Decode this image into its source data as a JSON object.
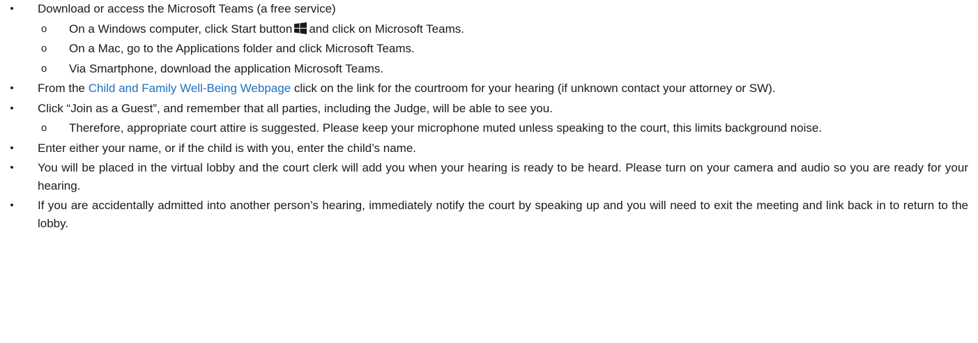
{
  "bullet_glyph": "•",
  "sub_bullet_glyph": "o",
  "items": [
    {
      "text": "Download or access the Microsoft Teams (a free service)",
      "sub": [
        {
          "before": "On a Windows computer, click Start button",
          "icon": "windows-logo-icon",
          "after": "and click on Microsoft Teams."
        },
        {
          "text": "On a Mac, go to the Applications folder and click Microsoft Teams."
        },
        {
          "text": "Via Smartphone, download the application Microsoft Teams."
        }
      ]
    },
    {
      "before": "From the ",
      "link": "Child and Family Well-Being Webpage",
      "after": " click on the link for the courtroom for your hearing (if unknown contact your attorney or SW)."
    },
    {
      "text": "Click “Join as a Guest”, and remember that all parties, including the Judge, will be able to see you.",
      "sub": [
        {
          "text": "Therefore, appropriate court attire is suggested. Please keep your microphone muted unless speaking to the court, this limits background noise."
        }
      ]
    },
    {
      "text": "Enter either your name, or if the child is with you, enter the child’s name."
    },
    {
      "text": "You will be placed in the virtual lobby and the court clerk will add you when your hearing is ready to be heard. Please turn on your camera and audio so you are ready for your hearing."
    },
    {
      "text": "If you are accidentally admitted into another person’s hearing, immediately notify the court by speaking up and you will need to exit the meeting and link back in to return to the lobby."
    }
  ],
  "colors": {
    "text": "#1a1a1a",
    "link": "#1f6fbf"
  }
}
